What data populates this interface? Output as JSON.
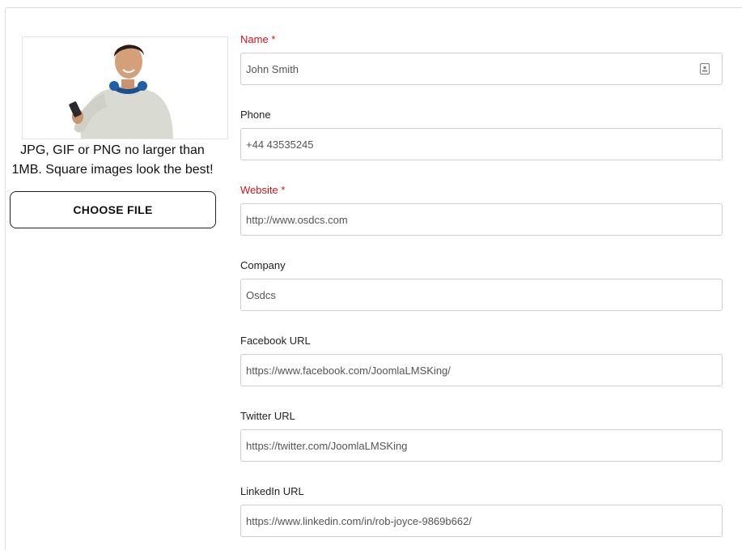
{
  "upload": {
    "hint": "JPG, GIF or PNG no larger than 1MB. Square images look the best!",
    "button_label": "CHOOSE FILE"
  },
  "fields": [
    {
      "label": "Name",
      "required_mark": "*",
      "value": "John Smith"
    },
    {
      "label": "Phone",
      "required_mark": "",
      "value": "+44 43535245"
    },
    {
      "label": "Website",
      "required_mark": "*",
      "value": "http://www.osdcs.com"
    },
    {
      "label": "Company",
      "required_mark": "",
      "value": "Osdcs"
    },
    {
      "label": "Facebook URL",
      "required_mark": "",
      "value": "https://www.facebook.com/JoomlaLMSKing/"
    },
    {
      "label": "Twitter URL",
      "required_mark": "",
      "value": "https://twitter.com/JoomlaLMSKing"
    },
    {
      "label": "LinkedIn URL",
      "required_mark": "",
      "value": "https://www.linkedin.com/in/rob-joyce-9869b662/"
    }
  ],
  "colors": {
    "required": "#d0141e",
    "border": "#cfcfcf",
    "text": "#222222"
  },
  "icons": {
    "avatar": "profile-photo",
    "name_field": "contact-card-icon"
  }
}
